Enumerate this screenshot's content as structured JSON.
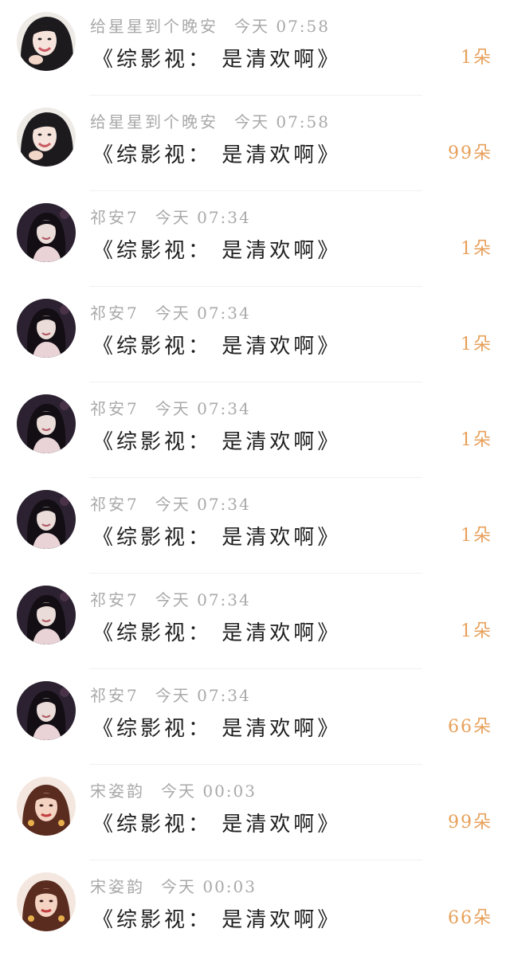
{
  "messages": [
    {
      "user": "给星星到个晚安",
      "time": "今天 07:58",
      "text": "《综影视： 是清欢啊》",
      "gift": "1朵",
      "avatar": "avatar-girl-light"
    },
    {
      "user": "给星星到个晚安",
      "time": "今天 07:58",
      "text": "《综影视： 是清欢啊》",
      "gift": "99朵",
      "avatar": "avatar-girl-light"
    },
    {
      "user": "祁安7",
      "time": "今天 07:34",
      "text": "《综影视： 是清欢啊》",
      "gift": "1朵",
      "avatar": "avatar-girl-dark"
    },
    {
      "user": "祁安7",
      "time": "今天 07:34",
      "text": "《综影视： 是清欢啊》",
      "gift": "1朵",
      "avatar": "avatar-girl-dark"
    },
    {
      "user": "祁安7",
      "time": "今天 07:34",
      "text": "《综影视： 是清欢啊》",
      "gift": "1朵",
      "avatar": "avatar-girl-dark"
    },
    {
      "user": "祁安7",
      "time": "今天 07:34",
      "text": "《综影视： 是清欢啊》",
      "gift": "1朵",
      "avatar": "avatar-girl-dark"
    },
    {
      "user": "祁安7",
      "time": "今天 07:34",
      "text": "《综影视： 是清欢啊》",
      "gift": "1朵",
      "avatar": "avatar-girl-dark"
    },
    {
      "user": "祁安7",
      "time": "今天 07:34",
      "text": "《综影视： 是清欢啊》",
      "gift": "66朵",
      "avatar": "avatar-girl-dark"
    },
    {
      "user": "宋姿韵",
      "time": "今天 00:03",
      "text": "《综影视： 是清欢啊》",
      "gift": "99朵",
      "avatar": "avatar-girl-warm"
    },
    {
      "user": "宋姿韵",
      "time": "今天 00:03",
      "text": "《综影视： 是清欢啊》",
      "gift": "66朵",
      "avatar": "avatar-girl-warm"
    }
  ],
  "colors": {
    "meta": "#a9a9a9",
    "text": "#1e1e1e",
    "gift": "#e7a05a"
  }
}
